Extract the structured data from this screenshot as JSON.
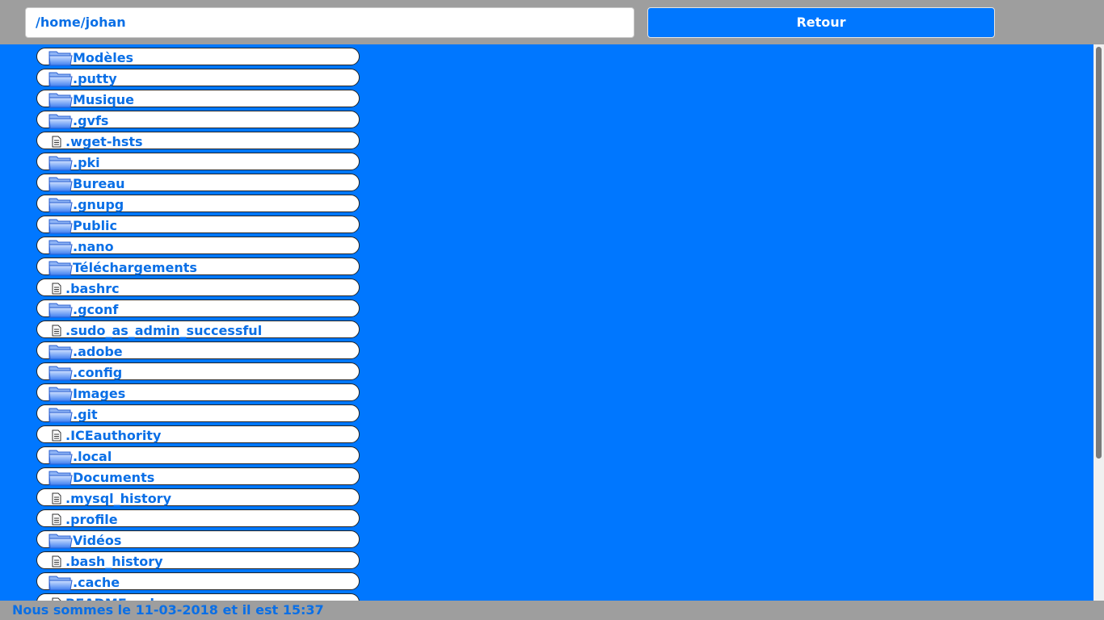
{
  "header": {
    "path_value": "/home/johan",
    "back_label": "Retour"
  },
  "icons": {
    "folder": "folder-icon",
    "file": "file-icon"
  },
  "colors": {
    "background": "#0077ff",
    "bar": "#9e9e9e",
    "text": "#0a6fe6"
  },
  "entries": [
    {
      "name": "Modèles",
      "type": "dir"
    },
    {
      "name": ".putty",
      "type": "dir"
    },
    {
      "name": "Musique",
      "type": "dir"
    },
    {
      "name": ".gvfs",
      "type": "dir"
    },
    {
      "name": ".wget-hsts",
      "type": "file"
    },
    {
      "name": ".pki",
      "type": "dir"
    },
    {
      "name": "Bureau",
      "type": "dir"
    },
    {
      "name": ".gnupg",
      "type": "dir"
    },
    {
      "name": "Public",
      "type": "dir"
    },
    {
      "name": ".nano",
      "type": "dir"
    },
    {
      "name": "Téléchargements",
      "type": "dir"
    },
    {
      "name": ".bashrc",
      "type": "file"
    },
    {
      "name": ".gconf",
      "type": "dir"
    },
    {
      "name": ".sudo_as_admin_successful",
      "type": "file"
    },
    {
      "name": ".adobe",
      "type": "dir"
    },
    {
      "name": ".config",
      "type": "dir"
    },
    {
      "name": "Images",
      "type": "dir"
    },
    {
      "name": ".git",
      "type": "dir"
    },
    {
      "name": ".ICEauthority",
      "type": "file"
    },
    {
      "name": ".local",
      "type": "dir"
    },
    {
      "name": "Documents",
      "type": "dir"
    },
    {
      "name": ".mysql_history",
      "type": "file"
    },
    {
      "name": ".profile",
      "type": "file"
    },
    {
      "name": "Vidéos",
      "type": "dir"
    },
    {
      "name": ".bash_history",
      "type": "file"
    },
    {
      "name": ".cache",
      "type": "dir"
    },
    {
      "name": "README.md",
      "type": "file"
    }
  ],
  "footer": {
    "status_text": "Nous sommes le 11-03-2018 et il est 15:37"
  }
}
